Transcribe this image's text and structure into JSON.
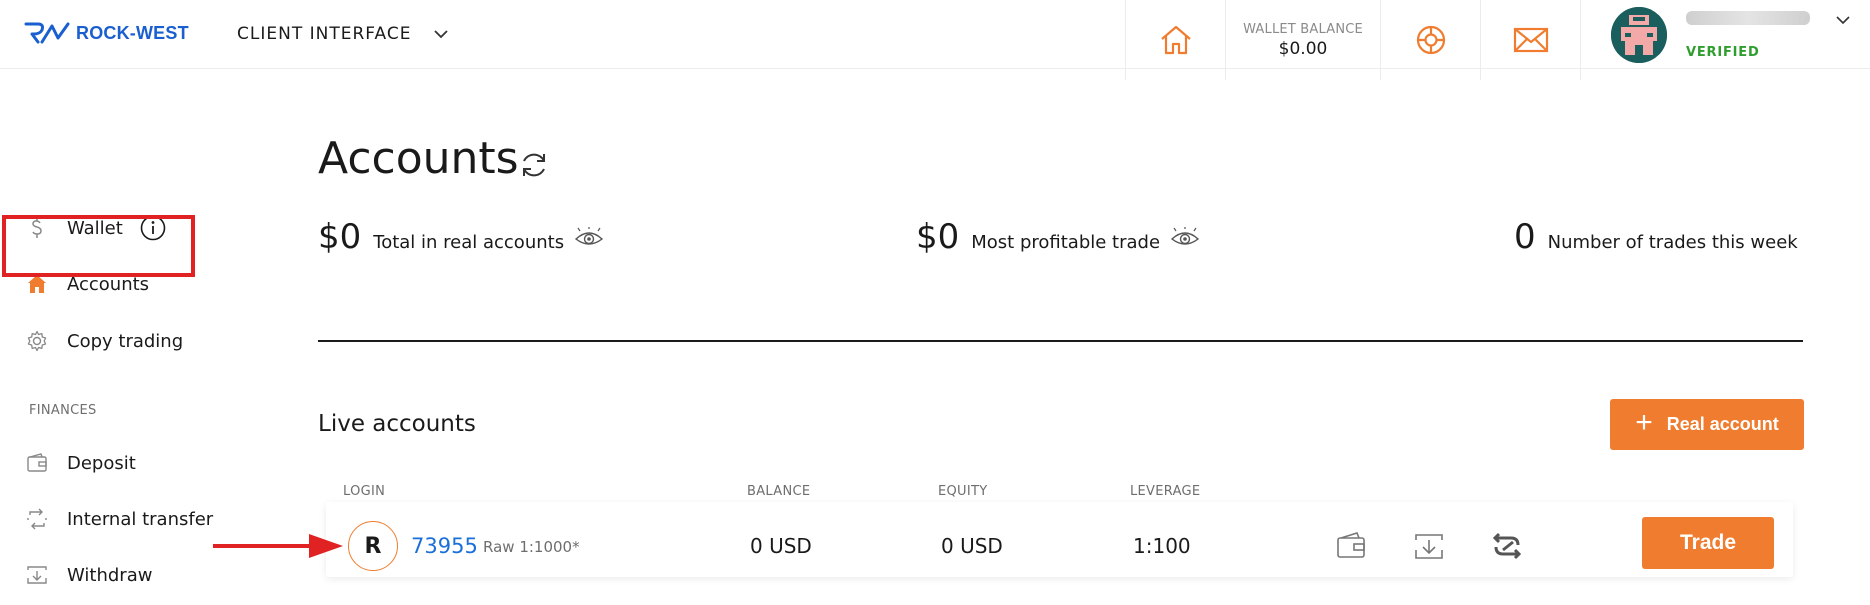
{
  "header": {
    "brand": "ROCK-WEST",
    "client_interface": "CLIENT INTERFACE",
    "wallet_balance_label": "WALLET BALANCE",
    "wallet_balance_value": "$0.00",
    "user_status": "VERIFIED"
  },
  "sidebar": {
    "items": [
      {
        "label": "Wallet",
        "icon": "dollar-icon"
      },
      {
        "label": "Accounts",
        "icon": "home-icon"
      },
      {
        "label": "Copy trading",
        "icon": "gear-icon"
      }
    ],
    "finances_label": "FINANCES",
    "finance_items": [
      {
        "label": "Deposit",
        "icon": "wallet-icon"
      },
      {
        "label": "Internal transfer",
        "icon": "transfer-icon"
      },
      {
        "label": "Withdraw",
        "icon": "withdraw-icon"
      }
    ]
  },
  "main": {
    "title": "Accounts",
    "stats": [
      {
        "value": "$0",
        "label": "Total in real accounts"
      },
      {
        "value": "$0",
        "label": "Most profitable trade"
      },
      {
        "value": "0",
        "label": "Number of trades this week"
      }
    ],
    "live_title": "Live accounts",
    "real_account_button": "Real account",
    "columns": [
      "LOGIN",
      "BALANCE",
      "EQUITY",
      "LEVERAGE"
    ],
    "account": {
      "badge": "R",
      "login": "73955",
      "type": "Raw 1:1000*",
      "balance": "0 USD",
      "equity": "0 USD",
      "leverage": "1:100",
      "trade_button": "Trade"
    }
  },
  "colors": {
    "accent": "#f07d2f",
    "brand_blue": "#1a5fd0",
    "link_blue": "#1a6fd8",
    "verified_green": "#2f9e2f",
    "annotation_red": "#e12222"
  }
}
